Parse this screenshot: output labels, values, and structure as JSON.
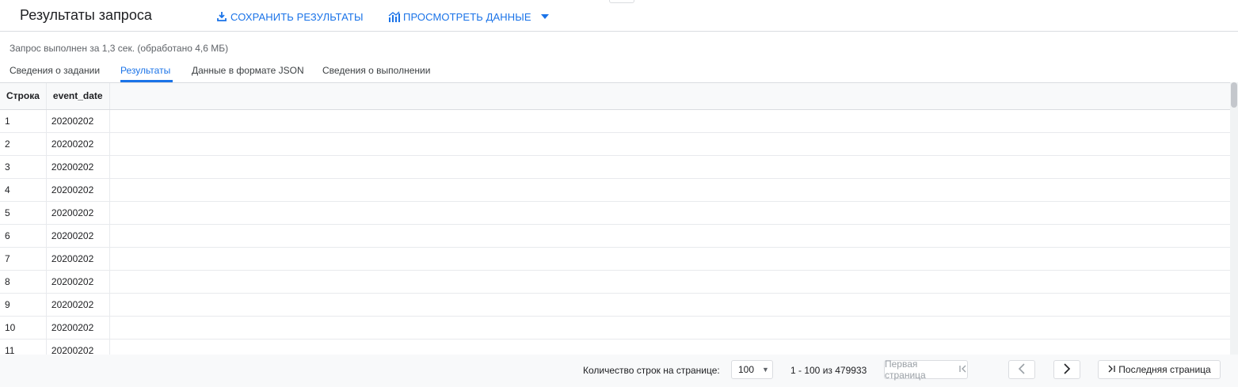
{
  "header": {
    "title": "Результаты запроса",
    "save_label": "СОХРАНИТЬ РЕЗУЛЬТАТЫ",
    "view_label": "ПРОСМОТРЕТЬ ДАННЫЕ"
  },
  "status": "Запрос выполнен за 1,3 сек. (обработано 4,6 МБ)",
  "tabs": [
    {
      "label": "Сведения о задании"
    },
    {
      "label": "Результаты"
    },
    {
      "label": "Данные в формате JSON"
    },
    {
      "label": "Сведения о выполнении"
    }
  ],
  "table": {
    "headers": [
      "Строка",
      "event_date"
    ],
    "rows": [
      [
        "1",
        "20200202"
      ],
      [
        "2",
        "20200202"
      ],
      [
        "3",
        "20200202"
      ],
      [
        "4",
        "20200202"
      ],
      [
        "5",
        "20200202"
      ],
      [
        "6",
        "20200202"
      ],
      [
        "7",
        "20200202"
      ],
      [
        "8",
        "20200202"
      ],
      [
        "9",
        "20200202"
      ],
      [
        "10",
        "20200202"
      ],
      [
        "11",
        "20200202"
      ]
    ]
  },
  "footer": {
    "rows_per_page_label": "Количество строк на странице:",
    "page_size": "100",
    "range": "1 - 100 из 479933",
    "first_page": "Первая страница",
    "last_page": "Последняя страница"
  },
  "colors": {
    "accent": "#1a73e8",
    "text": "#202124",
    "border": "#dadce0"
  }
}
